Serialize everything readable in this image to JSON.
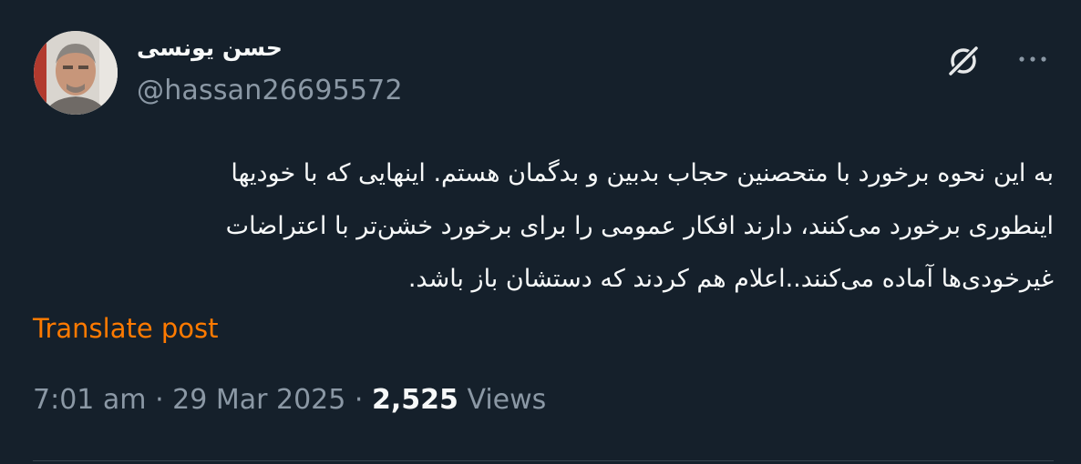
{
  "author": {
    "display_name": "حسن یونسی",
    "handle": "@hassan26695572"
  },
  "icons": {
    "grok": "grok-icon",
    "more": "more-icon",
    "avatar": "avatar"
  },
  "post": {
    "lines": [
      "به این نحوه برخورد با متحصنین حجاب بدبین و بدگمان هستم. اینهایی که با خودیها",
      "اینطوری برخورد می‌کنند، دارند افکار عمومی را برای برخورد خشن‌تر با اعتراضات",
      "غیرخودی‌ها آماده می‌کنند..اعلام هم کردند که دستشان باز باشد."
    ],
    "translate_label": "Translate post"
  },
  "meta": {
    "time": "7:01 am",
    "separator": "·",
    "date": "29 Mar 2025",
    "views_count": "2,525",
    "views_label": "Views"
  },
  "colors": {
    "background": "#15202b",
    "text": "#f7f9f9",
    "secondary_text": "#8b98a5",
    "accent": "#ff7a00"
  }
}
